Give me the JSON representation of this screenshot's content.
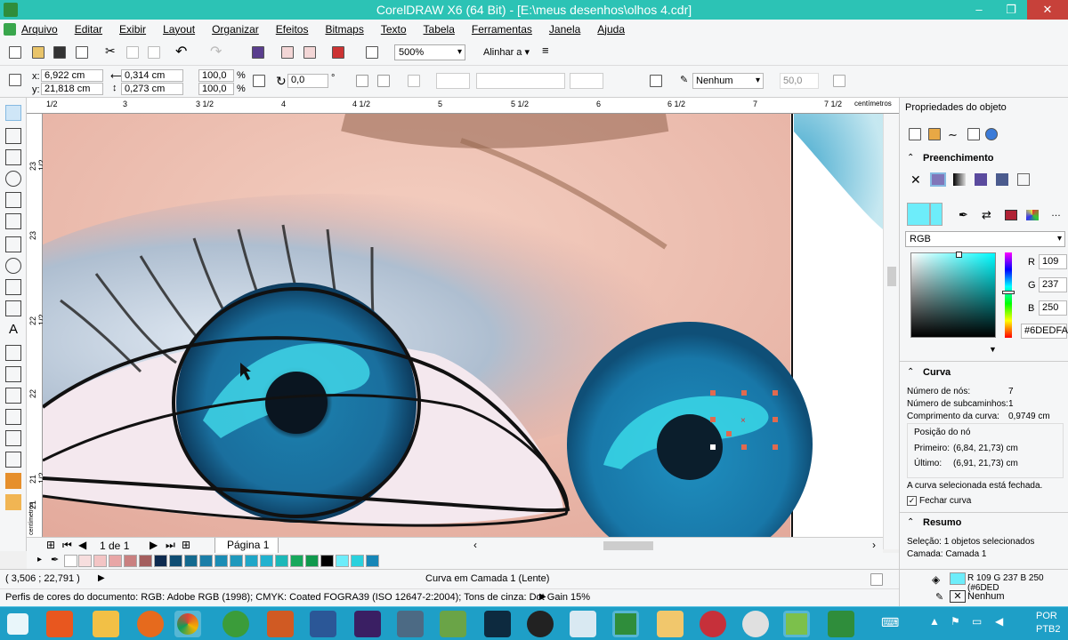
{
  "window": {
    "title": "CorelDRAW X6 (64 Bit) - [E:\\meus desenhos\\olhos 4.cdr]",
    "minimize": "–",
    "maximize": "❐",
    "close": "✕"
  },
  "menu": [
    "Arquivo",
    "Editar",
    "Exibir",
    "Layout",
    "Organizar",
    "Efeitos",
    "Bitmaps",
    "Texto",
    "Tabela",
    "Ferramentas",
    "Janela",
    "Ajuda"
  ],
  "toolbar": {
    "zoom": "500%",
    "align_label": "Alinhar a"
  },
  "property_bar": {
    "x_label": "x:",
    "x_value": "6,922 cm",
    "y_label": "y:",
    "y_value": "21,818 cm",
    "w_value": "0,314 cm",
    "h_value": "0,273 cm",
    "scale_x": "100,0",
    "scale_y": "100,0",
    "percent": "%",
    "rotation": "0,0",
    "degree": "°",
    "outline": "Nenhum",
    "smoothing": "50,0"
  },
  "rulers": {
    "top": [
      "1/2",
      "3",
      "3 1/2",
      "4",
      "4 1/2",
      "5",
      "5 1/2",
      "6",
      "6 1/2",
      "7",
      "7 1/2",
      "centímetros"
    ],
    "left": [
      "23 1/2",
      "23",
      "22 1/2",
      "22",
      "21 1/2",
      "21",
      "centímetros"
    ]
  },
  "page_nav": {
    "current": "1 de 1",
    "tab": "Página 1"
  },
  "palette": [
    "#f7dede",
    "#f3c5c5",
    "#e8a6a6",
    "#c98080",
    "#a45e5e",
    "#0d2a4f",
    "#0f4d73",
    "#136a8f",
    "#1a7ea8",
    "#1b8db5",
    "#1f99bd",
    "#20a7c8",
    "#22b2cf",
    "#1cb8b8",
    "#17a85c",
    "#11994d",
    "#000000",
    "#6dedfa",
    "#2ad1dd",
    "#1686b7"
  ],
  "status": {
    "coords": "( 3,506 ; 22,791 )",
    "object_info": "Curva em Camada 1  (Lente)",
    "color_profile": "Perfis de cores do documento: RGB: Adobe RGB (1998); CMYK: Coated FOGRA39 (ISO 12647-2:2004); Tons de cinza: Dot Gain 15%",
    "fill_value": "R 109 G 237 B 250 (#6DED",
    "outline_value": "Nenhum"
  },
  "docker": {
    "title": "Propriedades do objeto",
    "fill_section": "Preenchimento",
    "color_model": "RGB",
    "r_label": "R",
    "r_value": "109",
    "g_label": "G",
    "g_value": "237",
    "b_label": "B",
    "b_value": "250",
    "hex": "#6DEDFA",
    "fill_color": "#6DEDFA",
    "curve_section": "Curva",
    "node_count_label": "Número de nós:",
    "node_count": "7",
    "subpath_label": "Número de subcaminhos:",
    "subpath_count": "1",
    "length_label": "Comprimento da curva:",
    "length_value": "0,9749 cm",
    "node_pos_label": "Posição do nó",
    "first_label": "Primeiro:",
    "first_value": "(6,84, 21,73) cm",
    "last_label": "Último:",
    "last_value": "(6,91, 21,73) cm",
    "closed_msg": "A curva selecionada está fechada.",
    "close_curve": "Fechar curva",
    "summary_section": "Resumo",
    "selection": "Seleção:  1 objetos selecionados",
    "layer": "Camada: Camada 1"
  },
  "taskbar": {
    "lang": "POR",
    "kbd": "PTB2"
  }
}
